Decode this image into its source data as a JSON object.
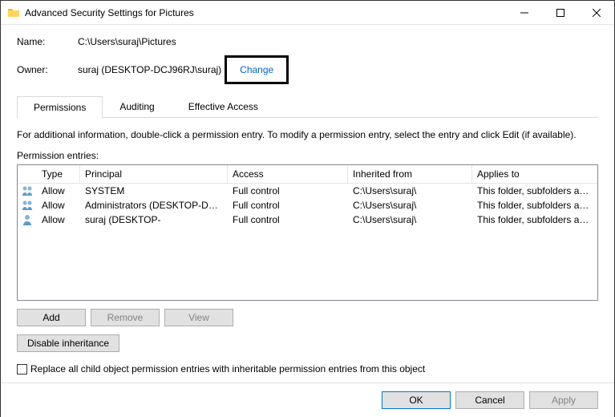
{
  "window": {
    "title": "Advanced Security Settings for Pictures"
  },
  "name": {
    "label": "Name:",
    "value": "C:\\Users\\suraj\\Pictures"
  },
  "owner": {
    "label": "Owner:",
    "value": "suraj (DESKTOP-DCJ96RJ\\suraj)",
    "change": "Change"
  },
  "tabs": {
    "permissions": "Permissions",
    "auditing": "Auditing",
    "effective": "Effective Access"
  },
  "infoText": "For additional information, double-click a permission entry. To modify a permission entry, select the entry and click Edit (if available).",
  "entriesLabel": "Permission entries:",
  "headers": {
    "type": "Type",
    "principal": "Principal",
    "access": "Access",
    "inherited": "Inherited from",
    "applies": "Applies to"
  },
  "rows": [
    {
      "icon": "group",
      "type": "Allow",
      "principal": "SYSTEM",
      "access": "Full control",
      "inherited": "C:\\Users\\suraj\\",
      "applies": "This folder, subfolders and files"
    },
    {
      "icon": "group",
      "type": "Allow",
      "principal": "Administrators (DESKTOP-DC...",
      "access": "Full control",
      "inherited": "C:\\Users\\suraj\\",
      "applies": "This folder, subfolders and files"
    },
    {
      "icon": "user",
      "type": "Allow",
      "principal": "suraj (DESKTOP-",
      "access": "Full control",
      "inherited": "C:\\Users\\suraj\\",
      "applies": "This folder, subfolders and files"
    }
  ],
  "buttons": {
    "add": "Add",
    "remove": "Remove",
    "view": "View",
    "disableInheritance": "Disable inheritance",
    "ok": "OK",
    "cancel": "Cancel",
    "apply": "Apply"
  },
  "checkbox": {
    "label": "Replace all child object permission entries with inheritable permission entries from this object"
  }
}
